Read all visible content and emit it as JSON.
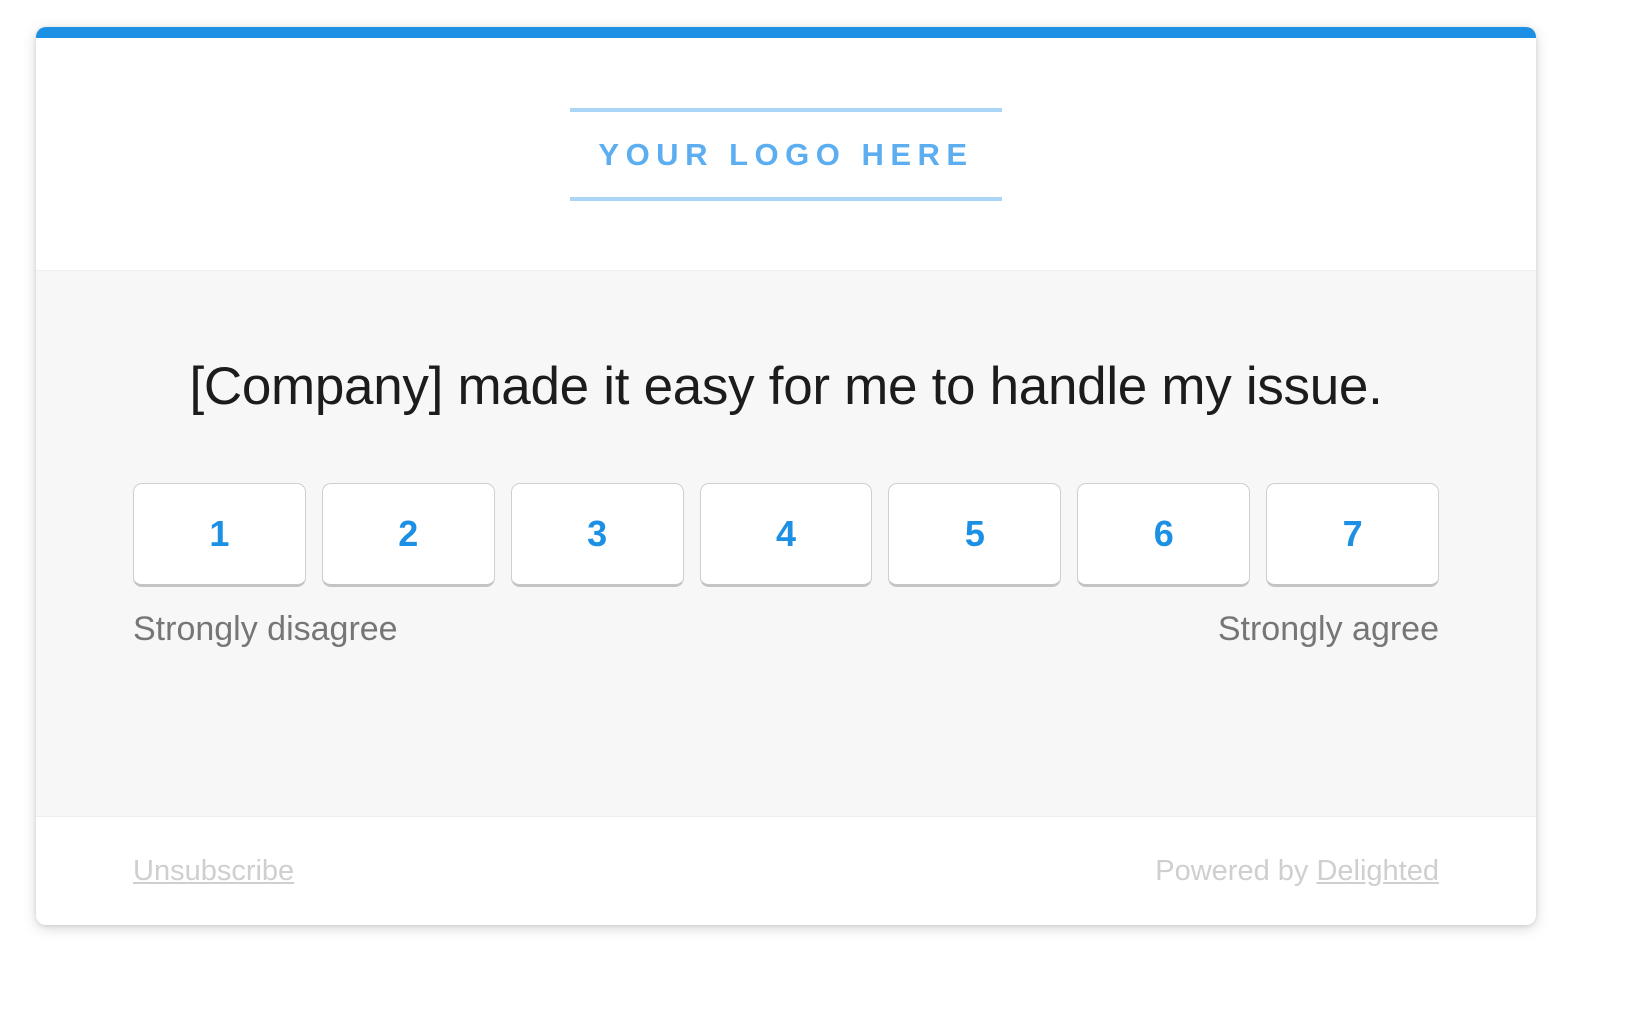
{
  "theme": {
    "accent_color": "#1c90e4",
    "logo_text_color": "#5caef0",
    "logo_rule_color": "#a9d6f6",
    "panel_background": "#f7f7f7",
    "button_number_color": "#1c90e4",
    "anchor_label_color": "#767676",
    "footer_text_color": "#cfcfcf"
  },
  "header": {
    "logo_placeholder": "YOUR LOGO HERE"
  },
  "survey": {
    "question": "[Company] made it easy for me to handle my issue.",
    "scale": {
      "options": [
        "1",
        "2",
        "3",
        "4",
        "5",
        "6",
        "7"
      ],
      "low_anchor": "Strongly disagree",
      "high_anchor": "Strongly agree"
    }
  },
  "footer": {
    "unsubscribe_label": "Unsubscribe",
    "powered_by_prefix": "Powered by ",
    "powered_by_brand": "Delighted"
  }
}
